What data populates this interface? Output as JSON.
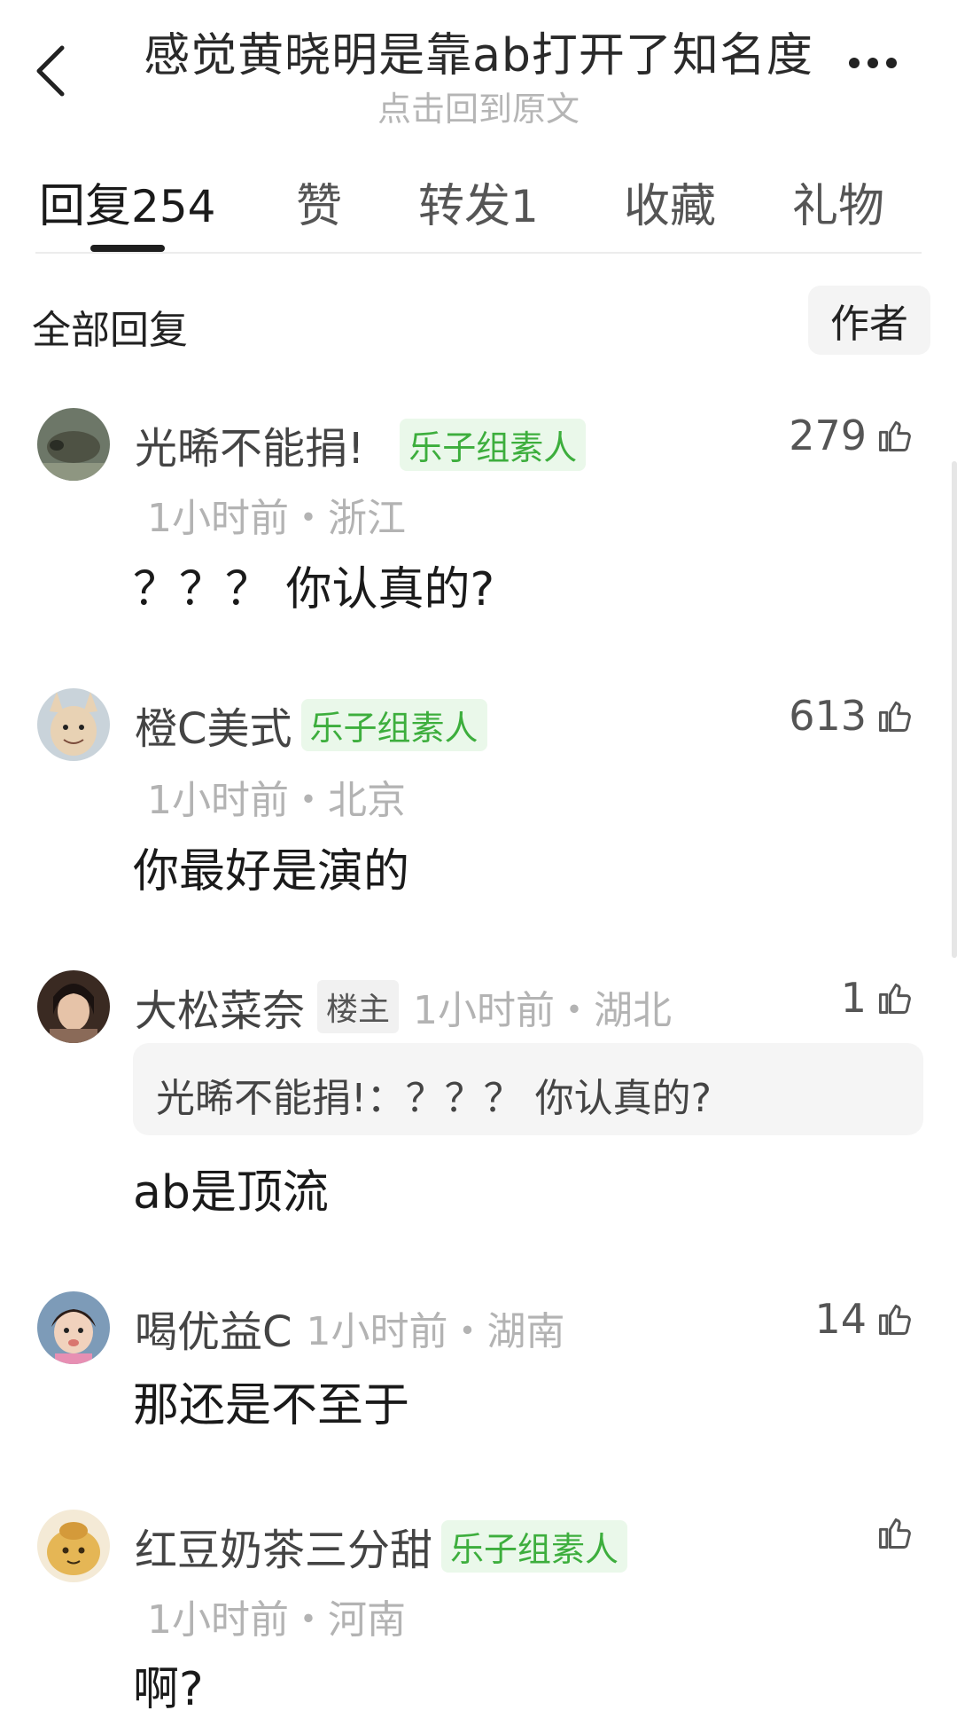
{
  "header": {
    "title": "感觉黄晓明是靠ab打开了知名度",
    "subtitle": "点击回到原文"
  },
  "tabs": [
    {
      "label": "回复",
      "count": "254",
      "active": true
    },
    {
      "label": "赞",
      "count": ""
    },
    {
      "label": "转发",
      "count": "1"
    },
    {
      "label": "收藏",
      "count": ""
    },
    {
      "label": "礼物",
      "count": ""
    }
  ],
  "filter": {
    "all_label": "全部回复",
    "author_label": "作者"
  },
  "comments": [
    {
      "name": "光晞不能捐!",
      "badge": "乐子组素人",
      "likes": "279",
      "time_location": "1小时前・浙江",
      "text": "？？？ 你认真的?"
    },
    {
      "name": "橙C美式",
      "badge": "乐子组素人",
      "likes": "613",
      "time_location": "1小时前・北京",
      "text": "你最好是演的"
    },
    {
      "name": "大松菜奈",
      "badge": "楼主",
      "likes": "1",
      "time_location": "1小时前・湖北",
      "quote": "光晞不能捐!：？？？ 你认真的?",
      "text": "ab是顶流"
    },
    {
      "name": "喝优益C",
      "badge": "",
      "likes": "14",
      "time_location": "1小时前・湖南",
      "text": "那还是不至于"
    },
    {
      "name": "红豆奶茶三分甜",
      "badge": "乐子组素人",
      "likes": "",
      "time_location": "1小时前・河南",
      "text": "啊?"
    }
  ],
  "colors": {
    "badge_green": "#3dae3d",
    "meta_gray": "#b3b3b3"
  }
}
